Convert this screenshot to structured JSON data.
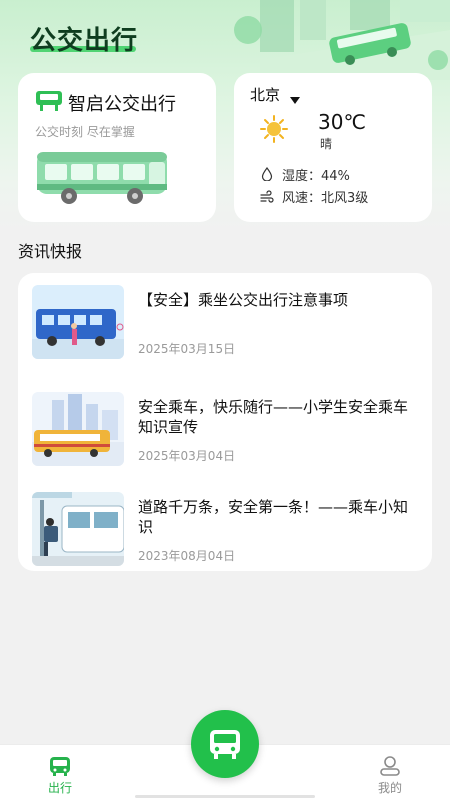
{
  "app": {
    "title": "公交出行"
  },
  "bus_card": {
    "title": "智启公交出行",
    "subtitle": "公交时刻 尽在掌握",
    "icon": "bus-stop-sign-icon"
  },
  "weather": {
    "city": "北京",
    "temperature": "30℃",
    "condition": "晴",
    "humidity": "湿度：44%",
    "wind": "风速：北风3级",
    "icons": [
      "sun-icon",
      "droplet-icon",
      "wind-icon"
    ]
  },
  "news": {
    "section_title": "资讯快报",
    "items": [
      {
        "title": "【安全】乘坐公交出行注意事项",
        "date": "2025年03月15日"
      },
      {
        "title": "安全乘车，快乐随行——小学生安全乘车知识宣传",
        "date": "2025年03月04日"
      },
      {
        "title": "道路千万条，安全第一条！——乘车小知识",
        "date": "2023年08月04日"
      }
    ]
  },
  "tabbar": {
    "home_label": "出行",
    "mine_label": "我的",
    "active_color": "#26b24c",
    "inactive_color": "#8a8a8a"
  },
  "colors": {
    "accent": "#22c04b",
    "background": "#f1f1f1"
  }
}
